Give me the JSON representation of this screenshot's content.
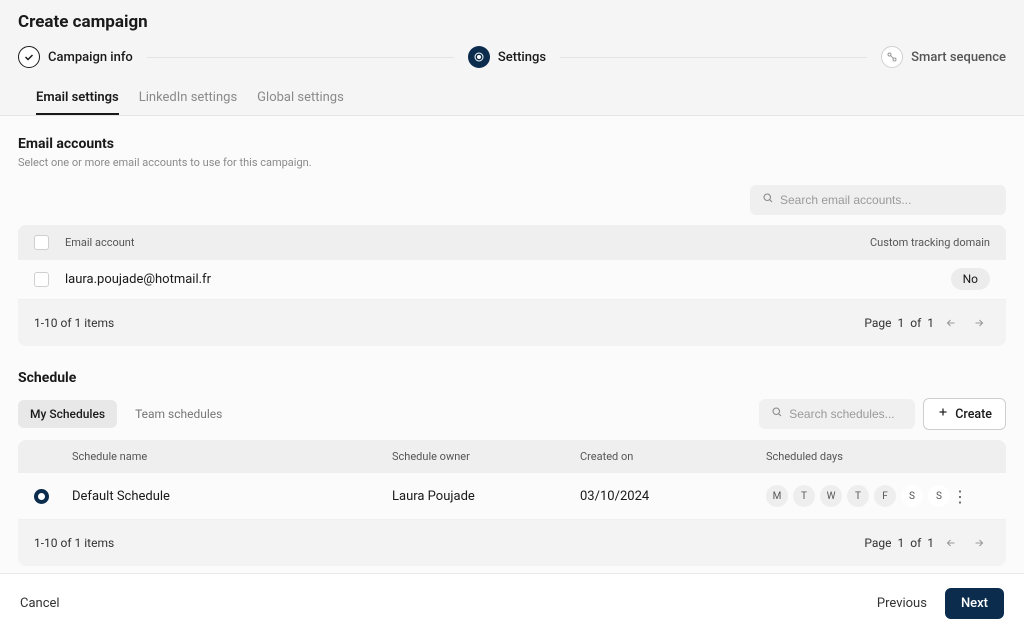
{
  "header": {
    "title": "Create campaign"
  },
  "stepper": {
    "step1_label": "Campaign info",
    "step2_label": "Settings",
    "step3_label": "Smart sequence"
  },
  "tabs": {
    "email": "Email settings",
    "linkedin": "LinkedIn settings",
    "global": "Global settings"
  },
  "email_accounts": {
    "title": "Email accounts",
    "desc": "Select one or more email accounts to use for this campaign.",
    "search_placeholder": "Search email accounts...",
    "col_account": "Email account",
    "col_tracking": "Custom tracking domain",
    "rows": [
      {
        "email": "laura.poujade@hotmail.fr",
        "tracking": "No"
      }
    ],
    "range_text": "1-10 of 1 items",
    "page_label": "Page",
    "page_current": "1",
    "page_of": "of",
    "page_total": "1"
  },
  "schedule": {
    "title": "Schedule",
    "tab_my": "My Schedules",
    "tab_team": "Team schedules",
    "search_placeholder": "Search schedules...",
    "create_label": "Create",
    "col_name": "Schedule name",
    "col_owner": "Schedule owner",
    "col_created": "Created on",
    "col_days": "Scheduled days",
    "rows": [
      {
        "name": "Default Schedule",
        "owner": "Laura Poujade",
        "created": "03/10/2024",
        "days": [
          "M",
          "T",
          "W",
          "T",
          "F",
          "S",
          "S"
        ],
        "days_on": [
          true,
          true,
          true,
          true,
          true,
          false,
          false
        ]
      }
    ],
    "range_text": "1-10 of 1 items",
    "page_label": "Page",
    "page_current": "1",
    "page_of": "of",
    "page_total": "1"
  },
  "footer": {
    "cancel": "Cancel",
    "previous": "Previous",
    "next": "Next"
  }
}
